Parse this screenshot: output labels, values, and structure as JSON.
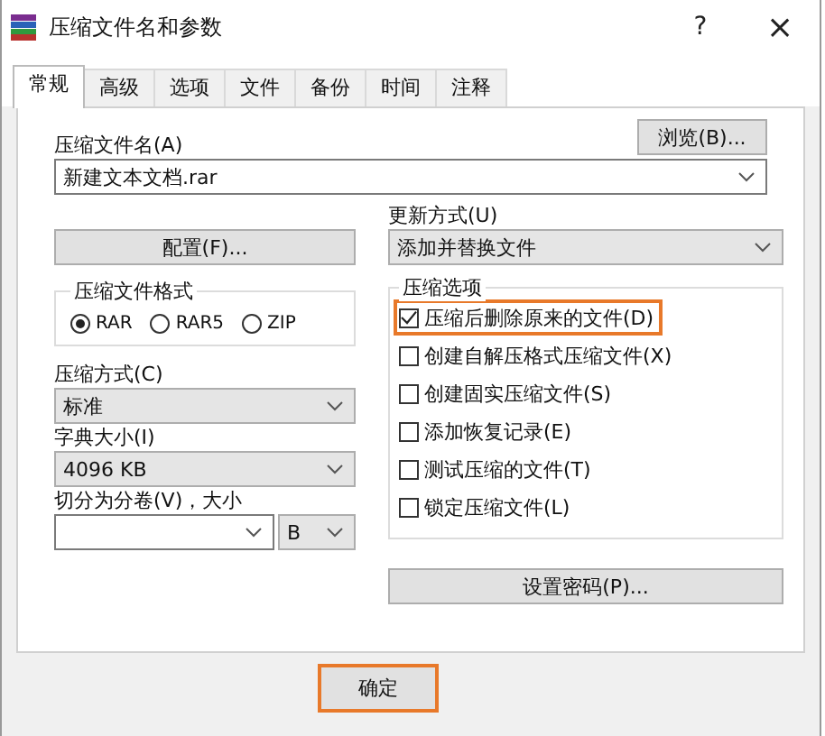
{
  "window": {
    "title": "压缩文件名和参数",
    "controls": [
      {
        "kind": "help",
        "label": "?"
      },
      {
        "kind": "close",
        "label": "×"
      }
    ]
  },
  "tabs": [
    {
      "label": "常规",
      "selected": true
    },
    {
      "label": "高级",
      "selected": false
    },
    {
      "label": "选项",
      "selected": false
    },
    {
      "label": "文件",
      "selected": false
    },
    {
      "label": "备份",
      "selected": false
    },
    {
      "label": "时间",
      "selected": false
    },
    {
      "label": "注释",
      "selected": false
    }
  ],
  "archive_name": {
    "label": "压缩文件名(A)",
    "value": "新建文本文档.rar",
    "browse_button": "浏览(B)..."
  },
  "profiles_button": "配置(F)...",
  "update_mode": {
    "label": "更新方式(U)",
    "value": "添加并替换文件"
  },
  "format": {
    "legend": "压缩文件格式",
    "options": [
      {
        "label": "RAR",
        "selected": true
      },
      {
        "label": "RAR5",
        "selected": false
      },
      {
        "label": "ZIP",
        "selected": false
      }
    ]
  },
  "method": {
    "label": "压缩方式(C)",
    "value": "标准"
  },
  "dictionary": {
    "label": "字典大小(I)",
    "value": "4096 KB"
  },
  "split": {
    "label": "切分为分卷(V)，大小",
    "unit": "B"
  },
  "options": {
    "legend": "压缩选项",
    "items": [
      {
        "label": "压缩后删除原来的文件(D)",
        "checked": true,
        "highlighted": true
      },
      {
        "label": "创建自解压格式压缩文件(X)",
        "checked": false,
        "highlighted": false
      },
      {
        "label": "创建固实压缩文件(S)",
        "checked": false,
        "highlighted": false
      },
      {
        "label": "添加恢复记录(E)",
        "checked": false,
        "highlighted": false
      },
      {
        "label": "测试压缩的文件(T)",
        "checked": false,
        "highlighted": false
      },
      {
        "label": "锁定压缩文件(L)",
        "checked": false,
        "highlighted": false
      }
    ]
  },
  "password_button": "设置密码(P)...",
  "buttons": [
    {
      "label": "确定",
      "highlighted": true
    }
  ]
}
